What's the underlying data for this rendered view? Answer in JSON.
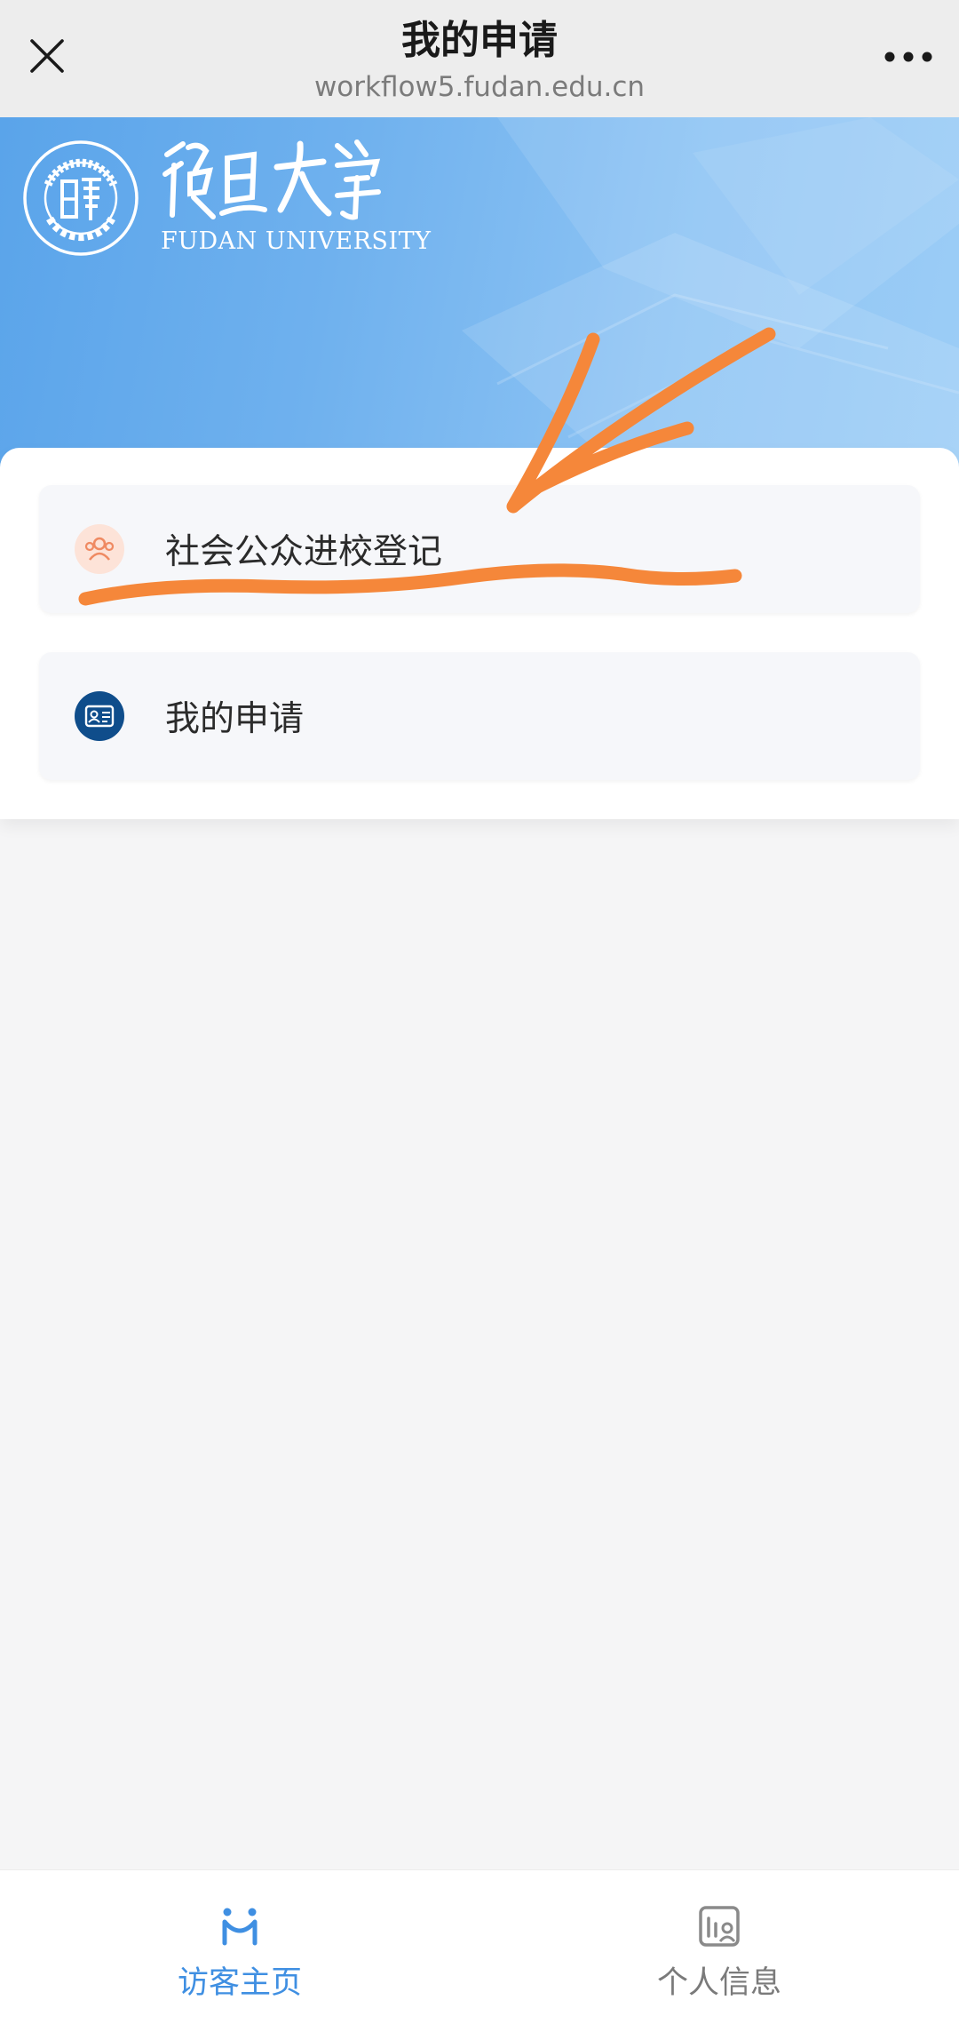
{
  "header": {
    "title": "我的申请",
    "url": "workflow5.fudan.edu.cn"
  },
  "banner": {
    "logo_text_en": "FUDAN UNIVERSITY",
    "logo_text_cn": "復旦大學",
    "seal_text": "FUDAN UNIVERSITY 1905"
  },
  "menu": {
    "items": [
      {
        "label": "社会公众进校登记",
        "icon": "people-group-icon"
      },
      {
        "label": "我的申请",
        "icon": "id-card-icon"
      }
    ]
  },
  "tabbar": {
    "tabs": [
      {
        "label": "访客主页",
        "icon": "visitor-home-icon",
        "active": true
      },
      {
        "label": "个人信息",
        "icon": "profile-info-icon",
        "active": false
      }
    ]
  },
  "colors": {
    "accent": "#3f8fe2",
    "annotation": "#f5873a",
    "banner_start": "#5aa4ea",
    "card_icon_navy": "#0f4d8b"
  }
}
